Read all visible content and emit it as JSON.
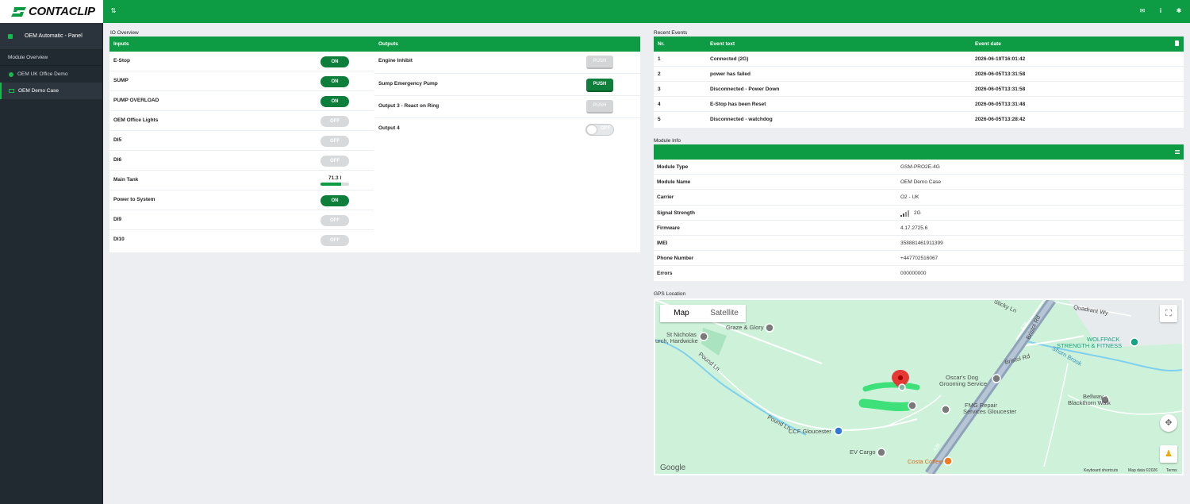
{
  "brand": {
    "logo_text": "CONTACLIP"
  },
  "topbar": {
    "icons": [
      "sliders-icon",
      "mail-icon",
      "info-icon",
      "gear-icon"
    ]
  },
  "sidebar": {
    "panel_label": "OEM Automatic - Panel",
    "section_label": "Module Overview",
    "items": [
      {
        "label": "OEM UK Office Demo",
        "icon": "status-dot-icon"
      },
      {
        "label": "OEM Demo Case",
        "icon": "mail-icon",
        "active": true
      }
    ]
  },
  "io_overview": {
    "title": "IO Overview",
    "inputs_header": "Inputs",
    "outputs_header": "Outputs",
    "inputs": [
      {
        "label": "E-Stop",
        "state": "ON"
      },
      {
        "label": "SUMP",
        "state": "ON"
      },
      {
        "label": "PUMP OVERLOAD",
        "state": "ON"
      },
      {
        "label": "OEM Office Lights",
        "state": "OFF"
      },
      {
        "label": "DI5",
        "state": "OFF"
      },
      {
        "label": "DI6",
        "state": "OFF"
      },
      {
        "label": "Main Tank",
        "value": "71.3 l",
        "level_fraction": 0.71
      },
      {
        "label": "Power to System",
        "state": "ON"
      },
      {
        "label": "DI9",
        "state": "OFF"
      },
      {
        "label": "DI10",
        "state": "OFF"
      }
    ],
    "outputs": [
      {
        "label": "Engine Inhibit",
        "control": "PUSH",
        "active": false
      },
      {
        "label": "Sump Emergency Pump",
        "control": "PUSH",
        "active": true
      },
      {
        "label": "Output 3 - React on Ring",
        "control": "PUSH",
        "active": false
      },
      {
        "label": "Output 4",
        "control": "OFF",
        "toggle": true
      }
    ]
  },
  "recent_events": {
    "title": "Recent Events",
    "columns": [
      "Nr.",
      "Event text",
      "Event date"
    ],
    "rows": [
      [
        "1",
        "Connected (2G)",
        "2026-06-19T16:01:42"
      ],
      [
        "2",
        "power has failed",
        "2026-06-05T13:31:58"
      ],
      [
        "3",
        "Disconnected - Power Down",
        "2026-06-05T13:31:58"
      ],
      [
        "4",
        "E-Stop has been Reset",
        "2026-06-05T13:31:48"
      ],
      [
        "5",
        "Disconnected - watchdog",
        "2026-06-05T13:28:42"
      ]
    ]
  },
  "module_info": {
    "title": "Module Info",
    "rows": [
      {
        "key": "Module Type",
        "value": "GSM-PRO2E-4G"
      },
      {
        "key": "Module Name",
        "value": "OEM Demo Case"
      },
      {
        "key": "Carrier",
        "value": "O2 - UK"
      },
      {
        "key": "Signal Strength",
        "value": "2G"
      },
      {
        "key": "Firmware",
        "value": "4.17.2725.6"
      },
      {
        "key": "IMEI",
        "value": "358881461911399"
      },
      {
        "key": "Phone Number",
        "value": "+447702516067"
      },
      {
        "key": "Errors",
        "value": "000000000"
      }
    ]
  },
  "gps": {
    "title": "GPS Location",
    "map_type_options": [
      "Map",
      "Satellite"
    ],
    "selected": "Map",
    "labels": [
      "Graze & Glory",
      "St Nicholas",
      "urch, Hardwicke",
      "Pound Ln",
      "Pound Ln",
      "CCF Gloucester",
      "EV Cargo",
      "Costa Coffee",
      "Oscar's Dog",
      "Grooming Service",
      "FMG Repair",
      "Services Gloucester",
      "Bristol Rd",
      "Bristol Rd",
      "A38",
      "A38",
      "WOLFPACK",
      "STRENGTH & FITNESS",
      "Quadrant Wy",
      "Bellway -",
      "Blackthorn Walk",
      "Shorn Brook",
      "Sticky Ln"
    ],
    "google": "Google",
    "footer": [
      "Keyboard shortcuts",
      "Map data ©2026",
      "Terms"
    ]
  }
}
